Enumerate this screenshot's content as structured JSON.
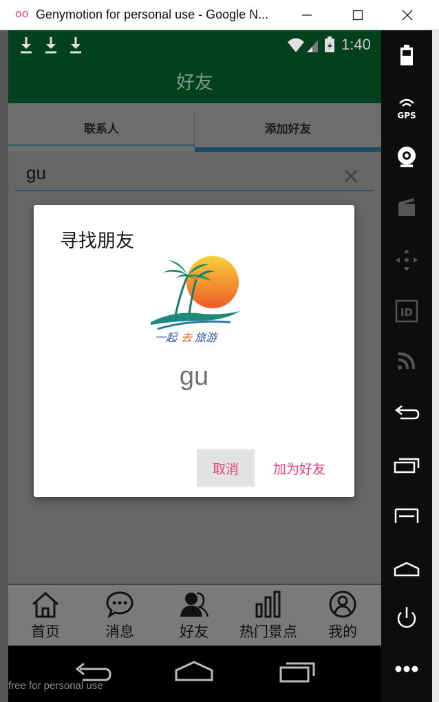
{
  "window": {
    "logo": "oo",
    "title": "Genymotion for personal use - Google N..."
  },
  "statusbar": {
    "time": "1:40"
  },
  "appbar": {
    "title": "好友"
  },
  "tabs": [
    {
      "label": "联系人"
    },
    {
      "label": "添加好友"
    }
  ],
  "search": {
    "value": "gu"
  },
  "dialog": {
    "title": "寻找朋友",
    "username": "gu",
    "cancel_label": "取消",
    "add_label": "加为好友",
    "accent_color": "#e8407a"
  },
  "bottom_nav": [
    {
      "label": "首页",
      "icon": "home-icon"
    },
    {
      "label": "消息",
      "icon": "message-icon"
    },
    {
      "label": "好友",
      "icon": "friends-icon"
    },
    {
      "label": "热门景点",
      "icon": "bar-chart-icon"
    },
    {
      "label": "我的",
      "icon": "profile-icon"
    }
  ],
  "watermark": "free for personal use",
  "colors": {
    "appbar": "#03401d",
    "overlay": "#666666"
  }
}
